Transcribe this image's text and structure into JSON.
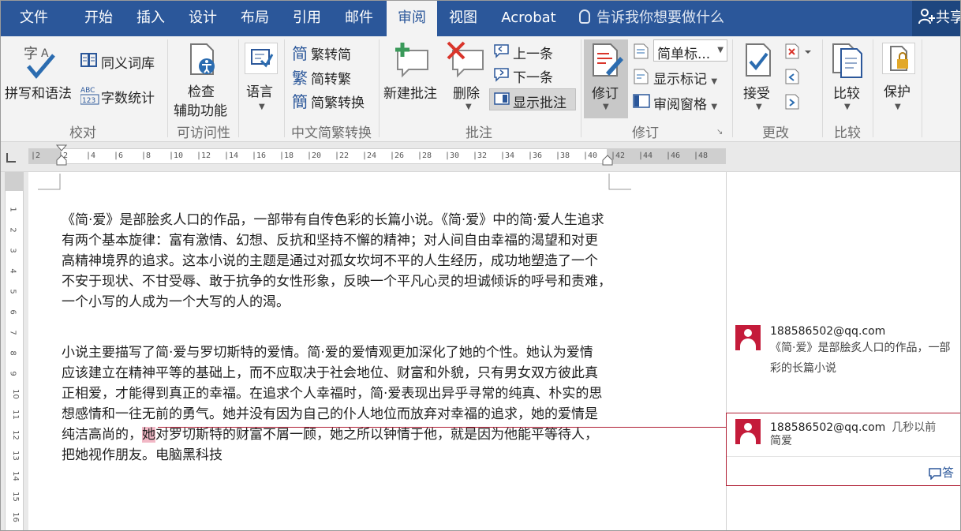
{
  "tabs": [
    {
      "label": "文件"
    },
    {
      "label": "开始"
    },
    {
      "label": "插入"
    },
    {
      "label": "设计"
    },
    {
      "label": "布局"
    },
    {
      "label": "引用"
    },
    {
      "label": "邮件"
    },
    {
      "label": "审阅"
    },
    {
      "label": "视图"
    },
    {
      "label": "Acrobat"
    }
  ],
  "active_tab": "审阅",
  "tell_me": "告诉我你想要做什么",
  "share_label": "共享",
  "ribbon": {
    "proofing": {
      "spelling": "拼写和语法",
      "thesaurus": "同义词库",
      "word_count": "字数统计",
      "group": "校对"
    },
    "accessibility": {
      "check_line1": "检查",
      "check_line2": "辅助功能",
      "group": "可访问性"
    },
    "language": {
      "label": "语言"
    },
    "chinese": {
      "to_simplified": "繁转简",
      "to_traditional": "简转繁",
      "convert": "简繁转换",
      "group": "中文简繁转换"
    },
    "comments": {
      "new": "新建批注",
      "delete": "删除",
      "previous": "上一条",
      "next": "下一条",
      "show": "显示批注",
      "group": "批注"
    },
    "tracking": {
      "track": "修订",
      "markup_mode": "简单标...",
      "show_markup": "显示标记",
      "reviewing_pane": "审阅窗格",
      "group": "修订"
    },
    "changes": {
      "accept": "接受",
      "group": "更改"
    },
    "compare": {
      "label": "比较",
      "group": "比较"
    },
    "protect": {
      "label": "保护"
    }
  },
  "ruler_ticks": [
    "2",
    "2",
    "4",
    "6",
    "8",
    "10",
    "12",
    "14",
    "16",
    "18",
    "20",
    "22",
    "24",
    "26",
    "28",
    "30",
    "32",
    "34",
    "36",
    "38",
    "40",
    "42",
    "44",
    "46",
    "48"
  ],
  "vruler_ticks": [
    "1",
    "2",
    "3",
    "4",
    "5",
    "6",
    "7",
    "8",
    "9",
    "10",
    "11",
    "12",
    "13",
    "14",
    "15",
    "16"
  ],
  "document": {
    "p1_lines": [
      "《简·爱》是部脍炙人口的作品，一部带有自传色彩的长篇小说。《简·爱》中的简·爱人生追求",
      "有两个基本旋律：富有激情、幻想、反抗和坚持不懈的精神；对人间自由幸福的渴望和对更",
      "高精神境界的追求。这本小说的主题是通过对孤女坎坷不平的人生经历，成功地塑造了一个",
      "不安于现状、不甘受辱、敢于抗争的女性形象，反映一个平凡心灵的坦诚倾诉的呼号和责难，",
      "一个小写的人成为一个大写的人的渴。"
    ],
    "p2_lines": [
      "小说主要描写了简·爱与罗切斯特的爱情。简·爱的爱情观更加深化了她的个性。她认为爱情",
      "应该建立在精神平等的基础上，而不应取决于社会地位、财富和外貌，只有男女双方彼此真",
      "正相爱，才能得到真正的幸福。在追求个人幸福时，简·爱表现出异乎寻常的纯真、朴实的思",
      "想感情和一往无前的勇气。她并没有因为自己的仆人地位而放弃对幸福的追求，她的爱情是"
    ],
    "p2_line5_before": "纯洁高尚的，",
    "p2_line5_marked": "她",
    "p2_line5_after": "对罗切斯特的财富不屑一顾，她之所以钟情于他，就是因为他能平等待人，",
    "p2_line6": "把她视作朋友。电脑黑科技"
  },
  "comments": [
    {
      "author": "188586502@qq.com",
      "time": "",
      "text_line1": "《简·爱》是部脍炙人口的作品，一部",
      "text_line2": "彩的长篇小说"
    },
    {
      "author": "188586502@qq.com",
      "time": "几秒以前",
      "text_line1": "简爱"
    }
  ],
  "reply_label": "答",
  "colors": {
    "ribbon_blue": "#2b579a",
    "comment_red": "#c41b3a",
    "highlight": "#f2b8c6"
  }
}
